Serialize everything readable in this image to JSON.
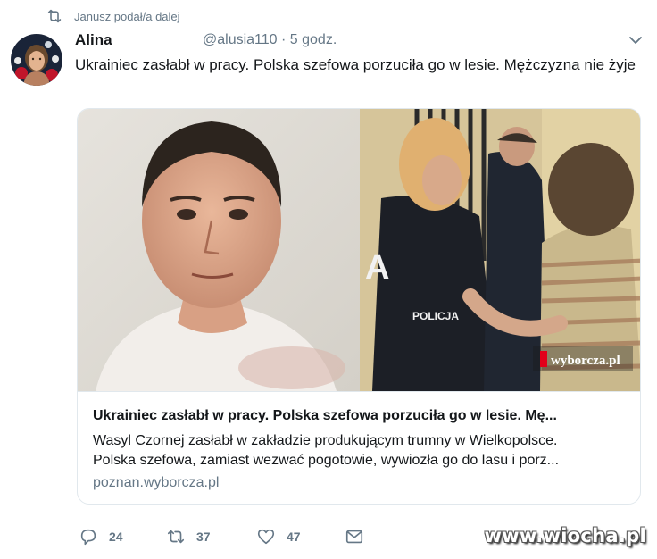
{
  "retweet": {
    "icon": "retweet-icon",
    "text": "Janusz podał/a dalej"
  },
  "author": {
    "name": "Alina",
    "handle": "@alusia110 · 5 godz."
  },
  "tweet": {
    "text": "Ukrainiec zasłabł w pracy. Polska szefowa porzuciła go w lesie. Mężczyzna nie żyje"
  },
  "card": {
    "title": "Ukrainiec zasłabł w pracy. Polska szefowa porzuciła go w lesie. Mę...",
    "desc_line1": "Wasyl Czornej zasłabł w zakładzie produkującym trumny w Wielkopolsce.",
    "desc_line2": "Polska szefowa, zamiast wezwać pogotowie, wywiozła go do lasu i porz...",
    "domain": "poznan.wyborcza.pl",
    "image_text": {
      "police_left": "A",
      "police_vest": "POLICJA",
      "logo": "wyborcza.pl"
    }
  },
  "actions": {
    "reply_count": "24",
    "retweet_count": "37",
    "like_count": "47"
  },
  "watermark": "www.wiocha.pl",
  "colors": {
    "muted": "#657786",
    "text": "#14171a",
    "border": "#e1e8ed",
    "wyborcza_red": "#e2001a"
  }
}
